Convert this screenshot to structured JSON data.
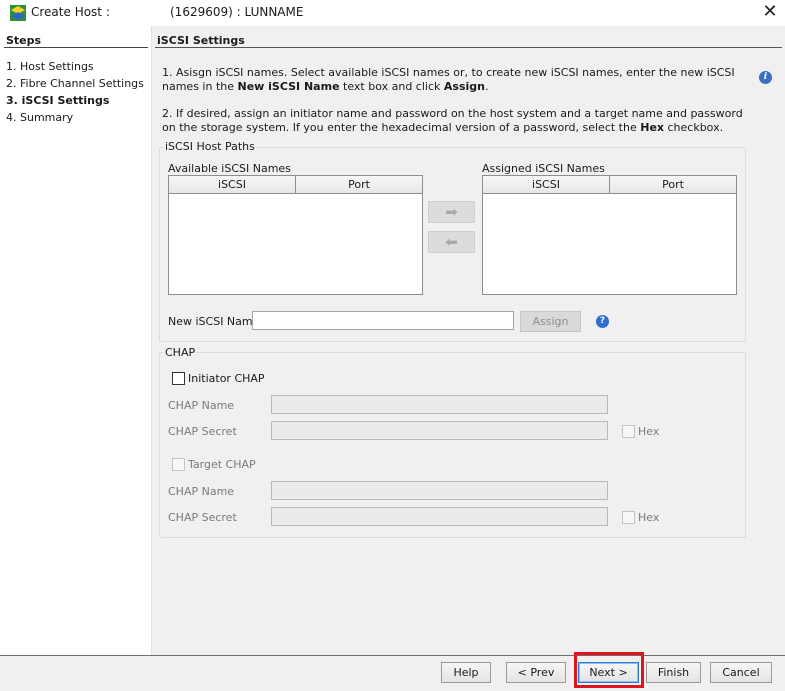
{
  "window": {
    "title_label": "Create Host :",
    "title_value": "(1629609) : LUNNAME",
    "close_symbol": "✕"
  },
  "steps": {
    "heading": "Steps",
    "items": [
      {
        "label": "1. Host Settings",
        "active": false
      },
      {
        "label": "2. Fibre Channel Settings",
        "active": false
      },
      {
        "label": "3. iSCSI Settings",
        "active": true
      },
      {
        "label": "4. Summary",
        "active": false
      }
    ]
  },
  "main": {
    "section_title": "iSCSI Settings",
    "instructions": [
      {
        "prefix": "1. Asisgn iSCSI names. Select available iSCSI names or, to create new iSCSI names, enter the new iSCSI names in the ",
        "bold1": "New iSCSI Name",
        "middle": " text box and click ",
        "bold2": "Assign",
        "suffix": "."
      },
      {
        "prefix": "2. If desired, assign an initiator name and password on the host system and a target name and password on the storage system. If you enter the hexadecimal version of a password, select the ",
        "bold1": "Hex",
        "middle": " checkbox.",
        "bold2": "",
        "suffix": ""
      }
    ],
    "host_paths": {
      "group_label": "iSCSI Host Paths",
      "available_label": "Available iSCSI Names",
      "assigned_label": "Assigned iSCSI Names",
      "columns": [
        "iSCSI",
        "Port"
      ],
      "new_name_label": "New iSCSI Name",
      "new_name_value": "",
      "assign_label": "Assign",
      "add_arrow": "➡",
      "remove_arrow": "⬅"
    },
    "chap": {
      "group_label": "CHAP",
      "initiator_label": "Initiator CHAP",
      "initiator_checked": false,
      "target_label": "Target CHAP",
      "target_checked": false,
      "name_label": "CHAP Name",
      "secret_label": "CHAP Secret",
      "hex_label": "Hex"
    }
  },
  "footer": {
    "help": "Help",
    "prev": "< Prev",
    "next": "Next >",
    "finish": "Finish",
    "cancel": "Cancel"
  },
  "colors": {
    "highlight": "#e0151b",
    "accent": "#2a7ad6"
  },
  "icons": {
    "app": "app-logo-icon",
    "info": "info-icon",
    "help": "help-icon"
  }
}
